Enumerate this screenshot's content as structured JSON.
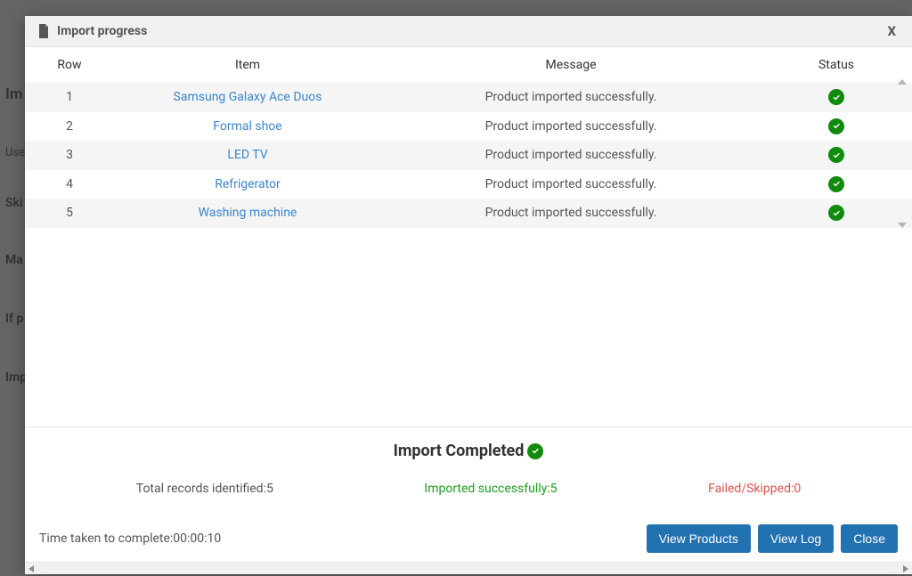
{
  "modal": {
    "title": "Import progress",
    "close": "X"
  },
  "table": {
    "headers": {
      "row": "Row",
      "item": "Item",
      "message": "Message",
      "status": "Status"
    },
    "rows": [
      {
        "row": "1",
        "item": "Samsung Galaxy Ace Duos",
        "message": "Product imported successfully.",
        "status": "ok"
      },
      {
        "row": "2",
        "item": "Formal shoe",
        "message": "Product imported successfully.",
        "status": "ok"
      },
      {
        "row": "3",
        "item": "LED TV",
        "message": "Product imported successfully.",
        "status": "ok"
      },
      {
        "row": "4",
        "item": "Refrigerator",
        "message": "Product imported successfully.",
        "status": "ok"
      },
      {
        "row": "5",
        "item": "Washing machine",
        "message": "Product imported successfully.",
        "status": "ok"
      }
    ]
  },
  "completed": {
    "title": "Import Completed",
    "total": "Total records identified:5",
    "imported": "Imported successfully:5",
    "failed": "Failed/Skipped:0"
  },
  "footer": {
    "time": "Time taken to complete:00:00:10",
    "view_products": "View Products",
    "view_log": "View Log",
    "close": "Close"
  },
  "background": {
    "labels": [
      "Im",
      "Use",
      "Ski",
      "Ma",
      "If p",
      "Imp"
    ]
  }
}
